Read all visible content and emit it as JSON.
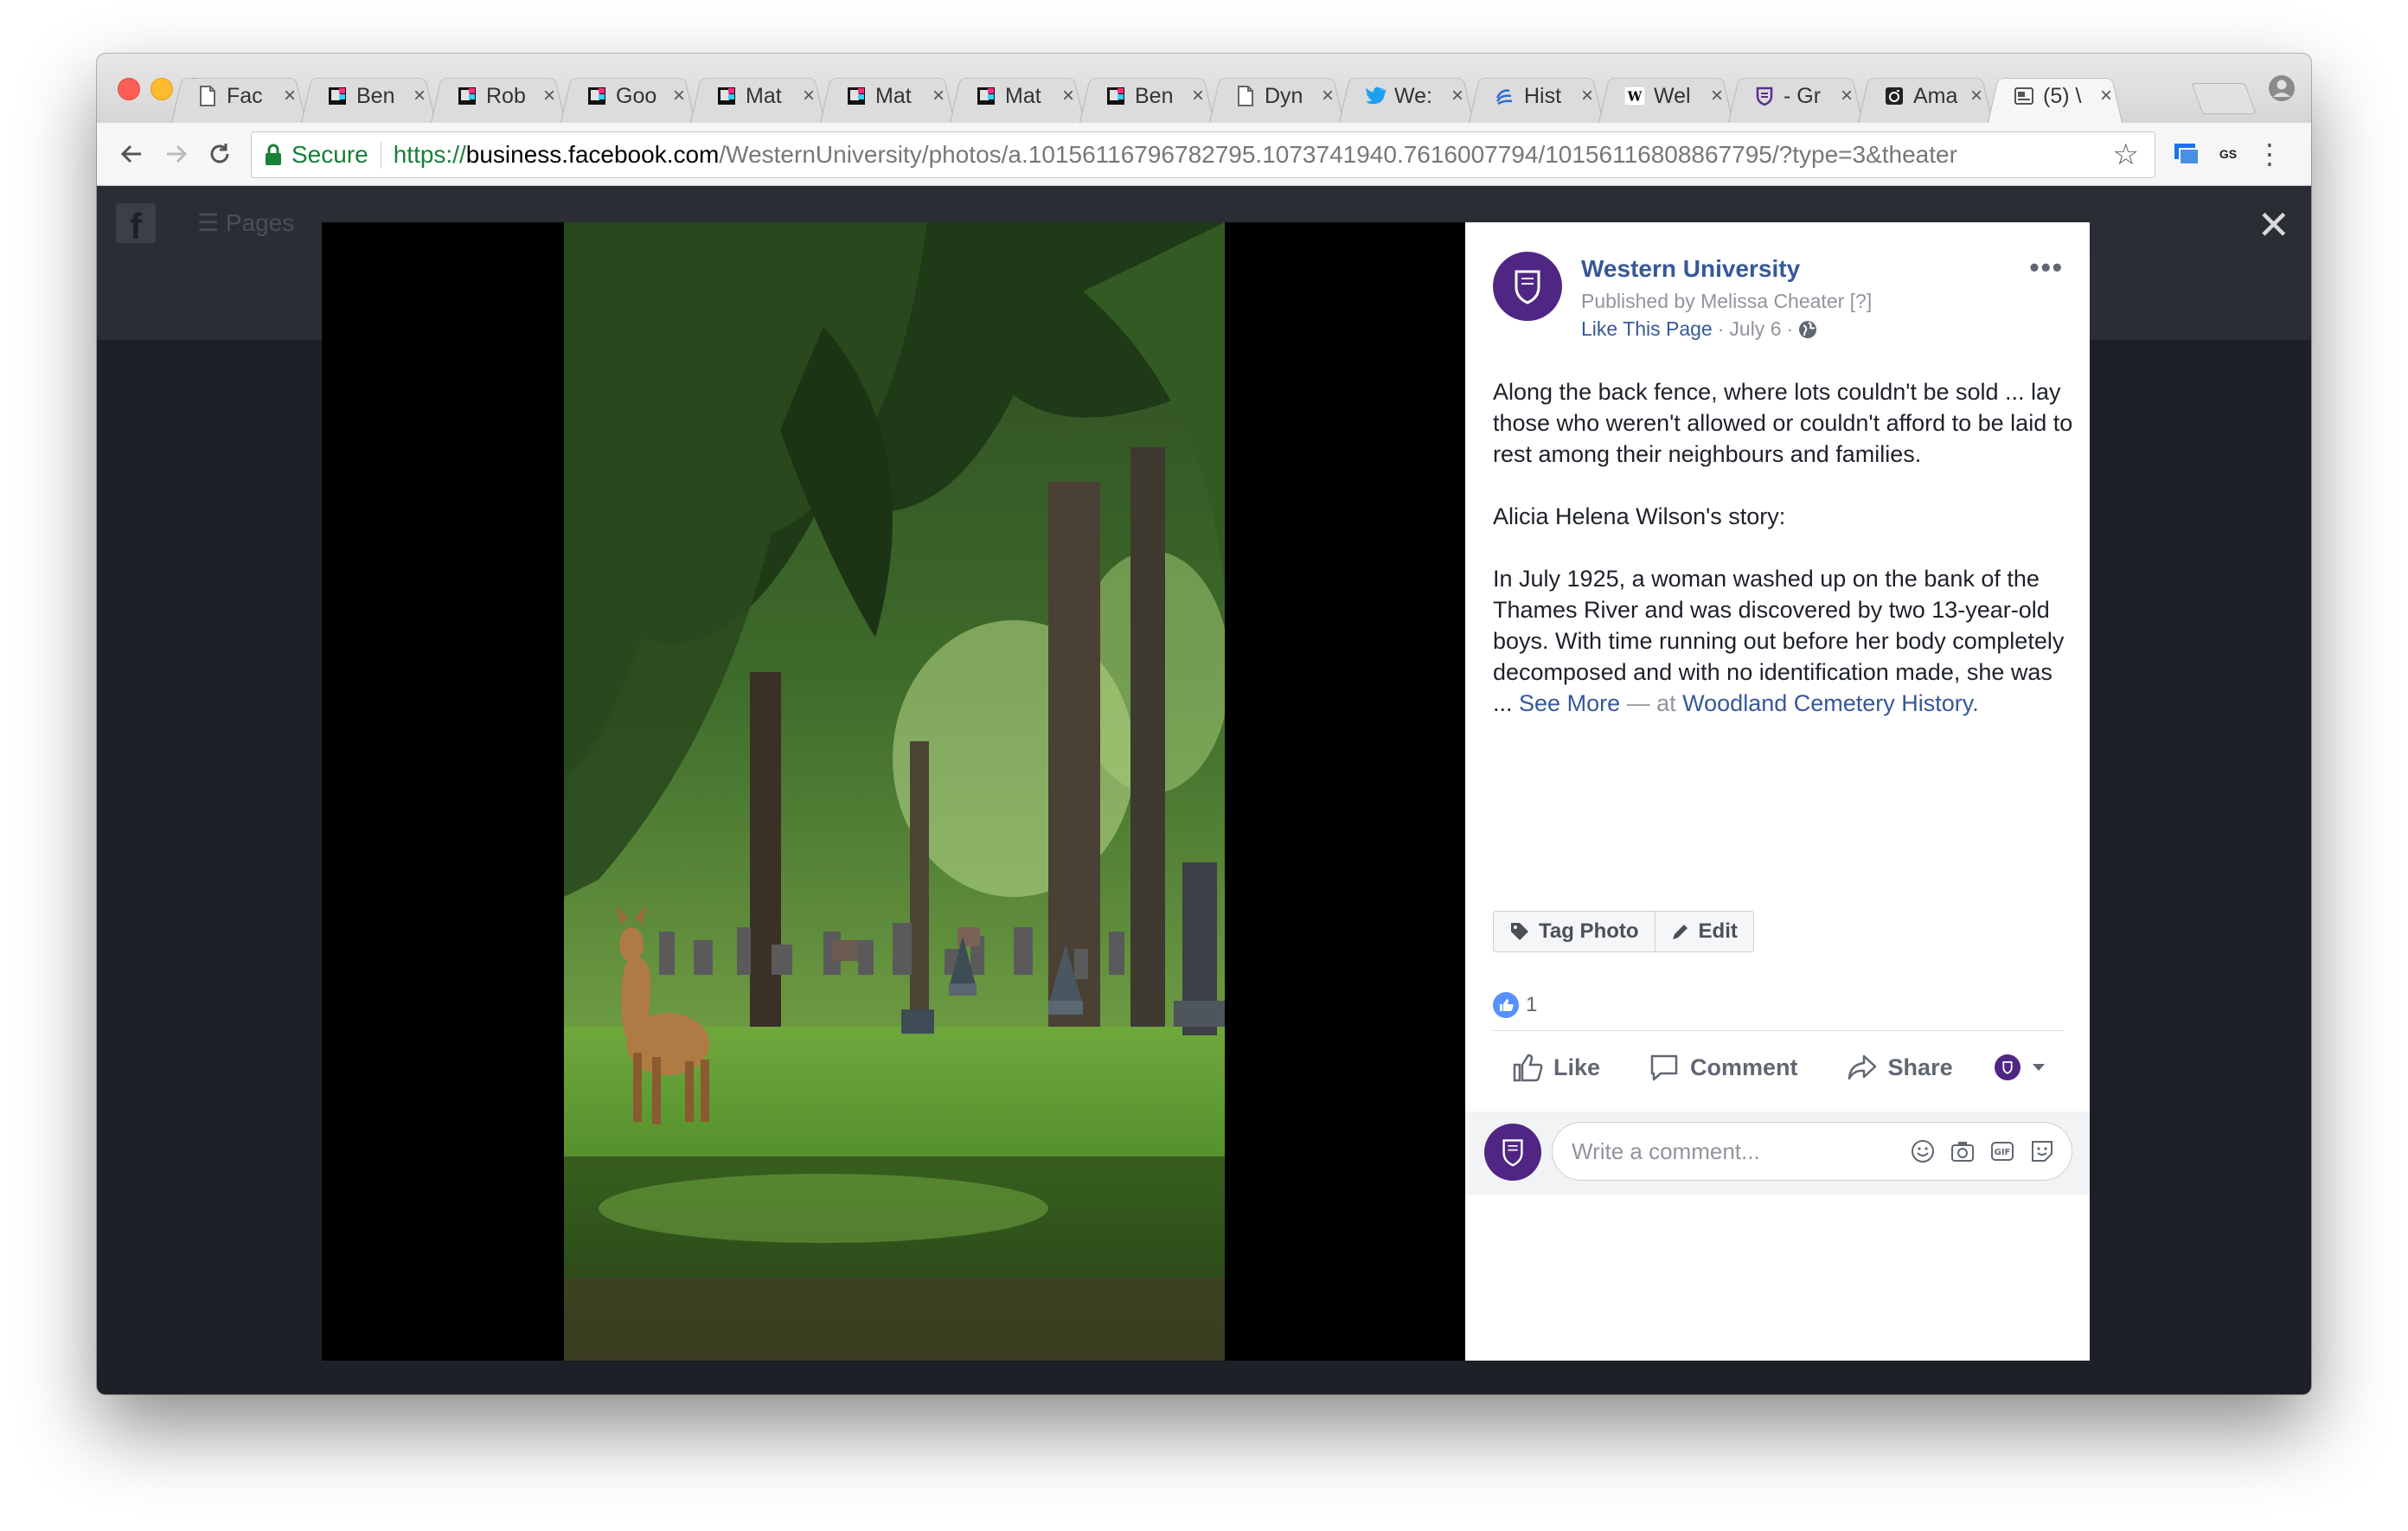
{
  "browser": {
    "tabs": [
      {
        "label": "Fac",
        "icon": "document-icon"
      },
      {
        "label": "Ben",
        "icon": "site-favicon-icon"
      },
      {
        "label": "Rob",
        "icon": "site-favicon-icon"
      },
      {
        "label": "Goo",
        "icon": "site-favicon-icon"
      },
      {
        "label": "Mat",
        "icon": "site-favicon-icon"
      },
      {
        "label": "Mat",
        "icon": "site-favicon-icon"
      },
      {
        "label": "Mat",
        "icon": "site-favicon-icon"
      },
      {
        "label": "Ben",
        "icon": "site-favicon-icon"
      },
      {
        "label": "Dyn",
        "icon": "document-icon"
      },
      {
        "label": "We:",
        "icon": "twitter-icon"
      },
      {
        "label": "Hist",
        "icon": "wave-icon"
      },
      {
        "label": "Wel",
        "icon": "wikipedia-icon"
      },
      {
        "label": "- Gr",
        "icon": "shield-crest-icon"
      },
      {
        "label": "Ama",
        "icon": "camera-icon"
      },
      {
        "label": "(5) \\",
        "icon": "facebook-page-icon",
        "active": true
      }
    ],
    "secure_label": "Secure",
    "url_scheme": "https://",
    "url_host": "business.facebook.com",
    "url_path": "/WesternUniversity/photos/a.10156116796782795.1073741940.7616007794/10156116808867795/?type=3&theater"
  },
  "fb": {
    "nav_label": "Pages"
  },
  "post": {
    "page_name": "Western University",
    "published_by": "Published by Melissa Cheater",
    "published_hint": "[?]",
    "like_page": "Like This Page",
    "date": "July 6",
    "caption_p1": "Along the back fence, where lots couldn't be sold ... lay those who weren't allowed or couldn't afford to be laid to rest among their neighbours and families.",
    "caption_p2": "Alicia Helena Wilson's story:",
    "caption_p3": "In July 1925, a woman washed up on the bank of the Thames River and was discovered by two 13-year-old boys. With time running out before her body completely decomposed and with no identification made, she was ...",
    "see_more": "See More",
    "at_label": "— at",
    "location": "Woodland Cemetery History.",
    "tag_photo": "Tag Photo",
    "edit": "Edit",
    "reaction_count": "1",
    "like": "Like",
    "comment": "Comment",
    "share": "Share",
    "comment_placeholder": "Write a comment...",
    "brand_color": "#4f2683",
    "link_color": "#365899"
  }
}
